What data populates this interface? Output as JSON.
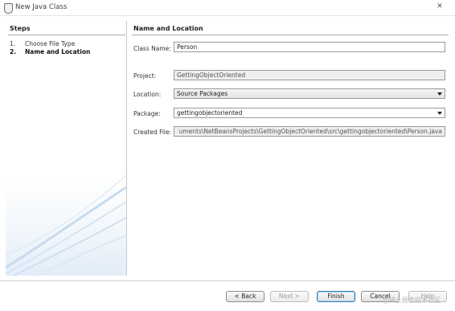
{
  "window": {
    "title": "New Java Class",
    "close_glyph": "✕"
  },
  "steps": {
    "title": "Steps",
    "items": [
      {
        "num": "1.",
        "label": "Choose File Type"
      },
      {
        "num": "2.",
        "label": "Name and Location"
      }
    ]
  },
  "form": {
    "section_title": "Name and Location",
    "class_name": {
      "label": "Class Name:",
      "value": "Person"
    },
    "project": {
      "label": "Project:",
      "value": "GettingObjectOriented"
    },
    "location": {
      "label": "Location:",
      "value": "Source Packages"
    },
    "package": {
      "label": "Package:",
      "value": "gettingobjectoriented"
    },
    "created_file": {
      "label": "Created File:",
      "value": "uments\\NetBeansProjects\\GettingObjectOriented\\src\\gettingobjectoriented\\Person.java"
    }
  },
  "buttons": {
    "back": "< Back",
    "next": "Next >",
    "finish": "Finish",
    "cancel": "Cancel",
    "help": "Help"
  },
  "watermark": "@稀土掘金技术社区"
}
